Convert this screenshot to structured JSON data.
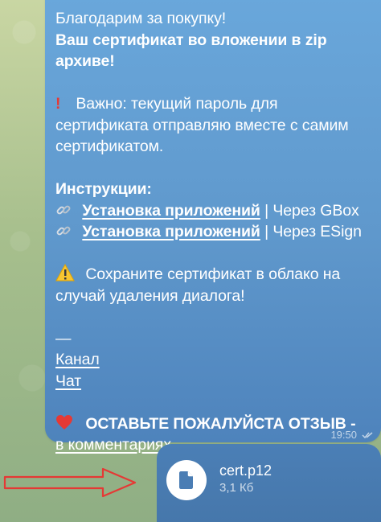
{
  "message": {
    "line1": "Благодарим за покупку!",
    "line2": "Ваш сертификат во вложении в zip",
    "line3": "архиве!",
    "important_prefix": "Важно: текущий пароль для",
    "important_line2": "сертификата отправляю вместе с самим",
    "important_line3": "сертификатом.",
    "instructions_label": "Инструкции:",
    "instruction_links": [
      {
        "link_text": "Установка приложений",
        "suffix": " | Через GBox"
      },
      {
        "link_text": "Установка приложений",
        "suffix": " | Через ESign"
      }
    ],
    "save_line1": "Сохраните сертификат в облако на",
    "save_line2": "случай удаления диалога!",
    "dash": "—",
    "channel_link": "Канал",
    "chat_link": "Чат",
    "review_line1": "ОСТАВЬТЕ ПОЖАЛУЙСТА ОТЗЫВ -",
    "review_link": "в комментариях",
    "time": "19:50"
  },
  "attachment": {
    "file_name": "cert.p12",
    "file_size": "3,1 Кб"
  },
  "colors": {
    "bubble_top": "#6aa8dc",
    "bubble_bottom": "#4e83bc",
    "file_bubble": "#4b7fb6",
    "arrow": "#e53935"
  },
  "icons": [
    "exclamation-icon",
    "link-icon",
    "warning-icon",
    "heart-icon",
    "double-check-icon",
    "file-icon",
    "red-arrow"
  ]
}
